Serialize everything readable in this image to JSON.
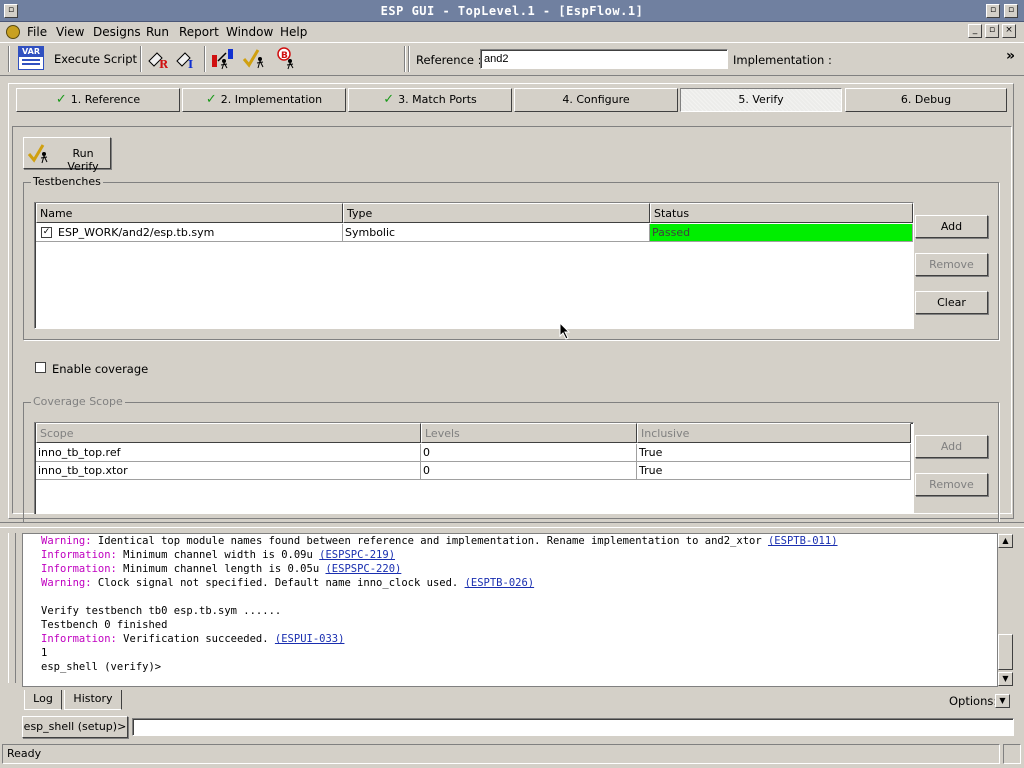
{
  "window": {
    "title": "ESP GUI - TopLevel.1 - [EspFlow.1]"
  },
  "menu": {
    "file": "File",
    "view": "View",
    "designs": "Designs",
    "run": "Run",
    "report": "Report",
    "window": "Window",
    "help": "Help"
  },
  "toolbar": {
    "var_icon_label": "VAR",
    "execute_script": "Execute Script",
    "reference_label": "Reference :",
    "reference_value": "and2",
    "implementation_label": "Implementation :",
    "overflow": "»"
  },
  "tabs": [
    {
      "label": "1. Reference",
      "done": true
    },
    {
      "label": "2. Implementation",
      "done": true
    },
    {
      "label": "3. Match Ports",
      "done": true
    },
    {
      "label": "4. Configure",
      "done": false
    },
    {
      "label": "5. Verify",
      "done": false,
      "active": true
    },
    {
      "label": "6. Debug",
      "done": false
    }
  ],
  "verify": {
    "run_button": "Run Verify",
    "testbenches_title": "Testbenches",
    "columns": [
      "Name",
      "Type",
      "Status"
    ],
    "rows": [
      {
        "name": "ESP_WORK/and2/esp.tb.sym",
        "type": "Symbolic",
        "status": "Passed",
        "checked": true
      }
    ],
    "status_passed_color": "#00ee00",
    "add": "Add",
    "remove": "Remove",
    "clear": "Clear",
    "enable_coverage": "Enable coverage",
    "coverage_title": "Coverage Scope",
    "coverage_columns": [
      "Scope",
      "Levels",
      "Inclusive"
    ],
    "coverage_rows": [
      {
        "scope": "inno_tb_top.ref",
        "levels": "0",
        "inclusive": "True"
      },
      {
        "scope": "inno_tb_top.xtor",
        "levels": "0",
        "inclusive": "True"
      }
    ],
    "coverage_add": "Add",
    "coverage_remove": "Remove"
  },
  "log": {
    "lines": [
      {
        "kind": "Warning:",
        "text": " Identical top module names found between reference and implementation. Rename implementation to and2_xtor ",
        "code": "(ESPTB-011)"
      },
      {
        "kind": "Information:",
        "text": " Minimum channel width is 0.09u ",
        "code": "(ESPSPC-219)"
      },
      {
        "kind": "Information:",
        "text": " Minimum channel length is 0.05u ",
        "code": "(ESPSPC-220)"
      },
      {
        "kind": "Warning:",
        "text": " Clock signal not specified. Default name inno_clock used. ",
        "code": "(ESPTB-026)"
      },
      {
        "kind": "",
        "text": "",
        "code": ""
      },
      {
        "kind": "",
        "text": "Verify testbench tb0 esp.tb.sym ......",
        "code": ""
      },
      {
        "kind": "",
        "text": "Testbench 0 finished",
        "code": ""
      },
      {
        "kind": "Information:",
        "text": " Verification succeeded. ",
        "code": "(ESPUI-033)"
      },
      {
        "kind": "",
        "text": "1",
        "code": ""
      },
      {
        "kind": "",
        "text": "esp_shell (verify)>",
        "code": ""
      }
    ],
    "tab_log": "Log",
    "tab_history": "History",
    "options": "Options:",
    "shell_prompt": "esp_shell (setup)>",
    "shell_input": ""
  },
  "status": {
    "text": "Ready"
  },
  "colors": {
    "titlebar": "#7080a0",
    "warning": "#c000c0",
    "link": "#1a2fb0"
  }
}
